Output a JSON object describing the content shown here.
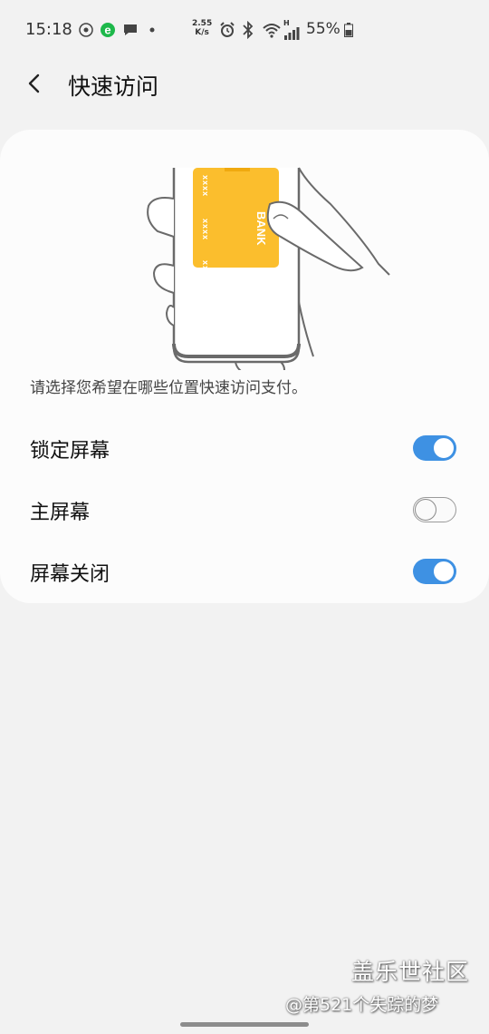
{
  "status_bar": {
    "time": "15:18",
    "net_speed_value": "2.55",
    "net_speed_unit": "K/s",
    "network_type": "H",
    "battery_percent": "55%",
    "icons": [
      "target-icon",
      "browser-e-icon",
      "chat-icon",
      "dot-icon",
      "alarm-icon",
      "bluetooth-icon",
      "wifi-icon",
      "signal-icon",
      "battery-icon"
    ]
  },
  "header": {
    "back_icon": "chevron-left-icon",
    "title": "快速访问"
  },
  "illustration": {
    "card_text": "BANK",
    "card_masked_number": "xxxx",
    "card_color": "#fbbe2d"
  },
  "main": {
    "description": "请选择您希望在哪些位置快速访问支付。",
    "settings": [
      {
        "label": "锁定屏幕",
        "enabled": true
      },
      {
        "label": "主屏幕",
        "enabled": false
      },
      {
        "label": "屏幕关闭",
        "enabled": true
      }
    ]
  },
  "watermark": {
    "brand": "盖乐世社区",
    "user": "@第521个失踪的梦"
  },
  "colors": {
    "toggle_on": "#3e91e3",
    "background": "#f2f2f2",
    "card": "#fcfcfc"
  }
}
